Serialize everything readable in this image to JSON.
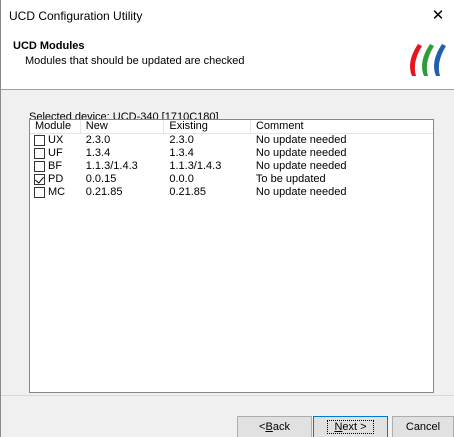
{
  "window": {
    "title": "UCD Configuration Utility",
    "close_glyph": "✕"
  },
  "header": {
    "title": "UCD Modules",
    "subtitle": "Modules that should be updated are checked",
    "logo_icon": "brand-stripes-logo",
    "logo_colors": [
      "#e3161f",
      "#2d9c3a",
      "#1f5fb0"
    ]
  },
  "selected_device": "Selected device: UCD-340 [1710C180]",
  "table": {
    "columns": [
      "Module",
      "New",
      "Existing",
      "Comment"
    ],
    "rows": [
      {
        "checked": false,
        "module": "UX",
        "new": "2.3.0",
        "existing": "2.3.0",
        "comment": "No update needed"
      },
      {
        "checked": false,
        "module": "UF",
        "new": "1.3.4",
        "existing": "1.3.4",
        "comment": "No update needed"
      },
      {
        "checked": false,
        "module": "BF",
        "new": "1.1.3/1.4.3",
        "existing": "1.1.3/1.4.3",
        "comment": "No update needed"
      },
      {
        "checked": true,
        "module": "PD",
        "new": "0.0.15",
        "existing": "0.0.0",
        "comment": "To be updated"
      },
      {
        "checked": false,
        "module": "MC",
        "new": "0.21.85",
        "existing": "0.21.85",
        "comment": "No update needed"
      }
    ]
  },
  "buttons": {
    "back": {
      "prefix": "< ",
      "mnemonic": "B",
      "rest": "ack"
    },
    "next": {
      "mnemonic": "N",
      "rest": "ext >"
    },
    "cancel": "Cancel"
  }
}
